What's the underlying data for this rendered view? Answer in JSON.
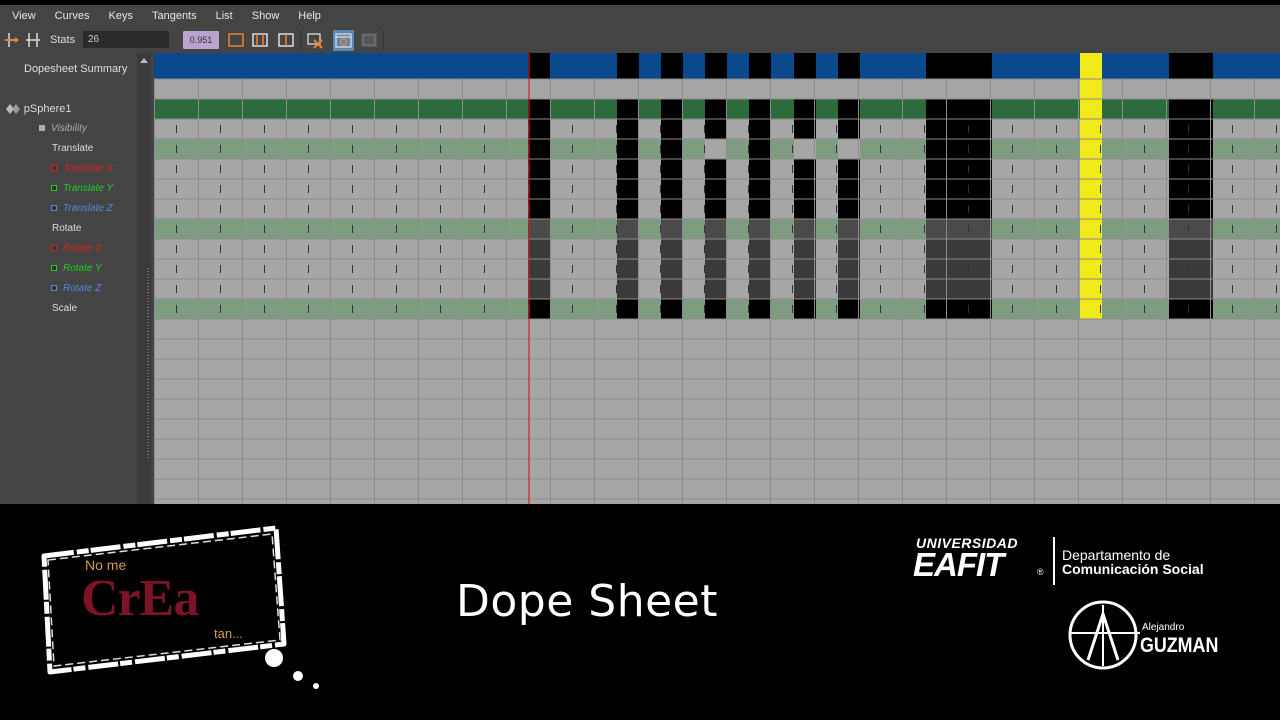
{
  "menu": [
    "View",
    "Curves",
    "Keys",
    "Tangents",
    "List",
    "Show",
    "Help"
  ],
  "toolbar": {
    "stats_label": "Stats",
    "stats_value": "26",
    "value_field": "0.951",
    "icons": [
      "insert-key-icon",
      "move-keys-icon",
      "frame-all-icon",
      "frame-selection-icon",
      "frame-playback-icon",
      "delete-channel-icon",
      "summary-toggle-icon",
      "hierarchy-toggle-icon"
    ]
  },
  "outliner": {
    "summary": "Dopesheet Summary",
    "object": "pSphere1",
    "channels": [
      {
        "label": "Visibility",
        "color": "#aaaaaa",
        "italic": true
      },
      {
        "label": "Translate",
        "color": "#dddddd",
        "group": true
      },
      {
        "label": "Translate X",
        "color": "#e02020",
        "italic": true
      },
      {
        "label": "Translate Y",
        "color": "#22cc22",
        "italic": true
      },
      {
        "label": "Translate Z",
        "color": "#5588dd",
        "italic": true
      },
      {
        "label": "Rotate",
        "color": "#dddddd",
        "group": true
      },
      {
        "label": "Rotate X",
        "color": "#e02020",
        "italic": true
      },
      {
        "label": "Rotate Y",
        "color": "#22cc22",
        "italic": true
      },
      {
        "label": "Rotate Z",
        "color": "#5588dd",
        "italic": true
      },
      {
        "label": "Scale",
        "color": "#dddddd",
        "group": true
      }
    ]
  },
  "dopesheet": {
    "current_frame_marker_color": "#d82020",
    "selected_key_color": "#f0ea1a",
    "summary_key_color": "#0a4a8c",
    "object_row_color": "#2d6a3c",
    "group_row_color": "#7f9c80",
    "key_color": "#000000"
  },
  "banner": {
    "title": "Dope Sheet",
    "crea": {
      "top": "No me",
      "word": "CrEa",
      "bottom": "tan..."
    },
    "eafit": {
      "univ": "UNIVERSIDAD",
      "name": "EAFIT",
      "reg": "®",
      "dept_line1": "Departamento de",
      "dept_line2": "Comunicación Social"
    },
    "author": {
      "first": "Alejandro",
      "last": "GUZMAN"
    }
  }
}
